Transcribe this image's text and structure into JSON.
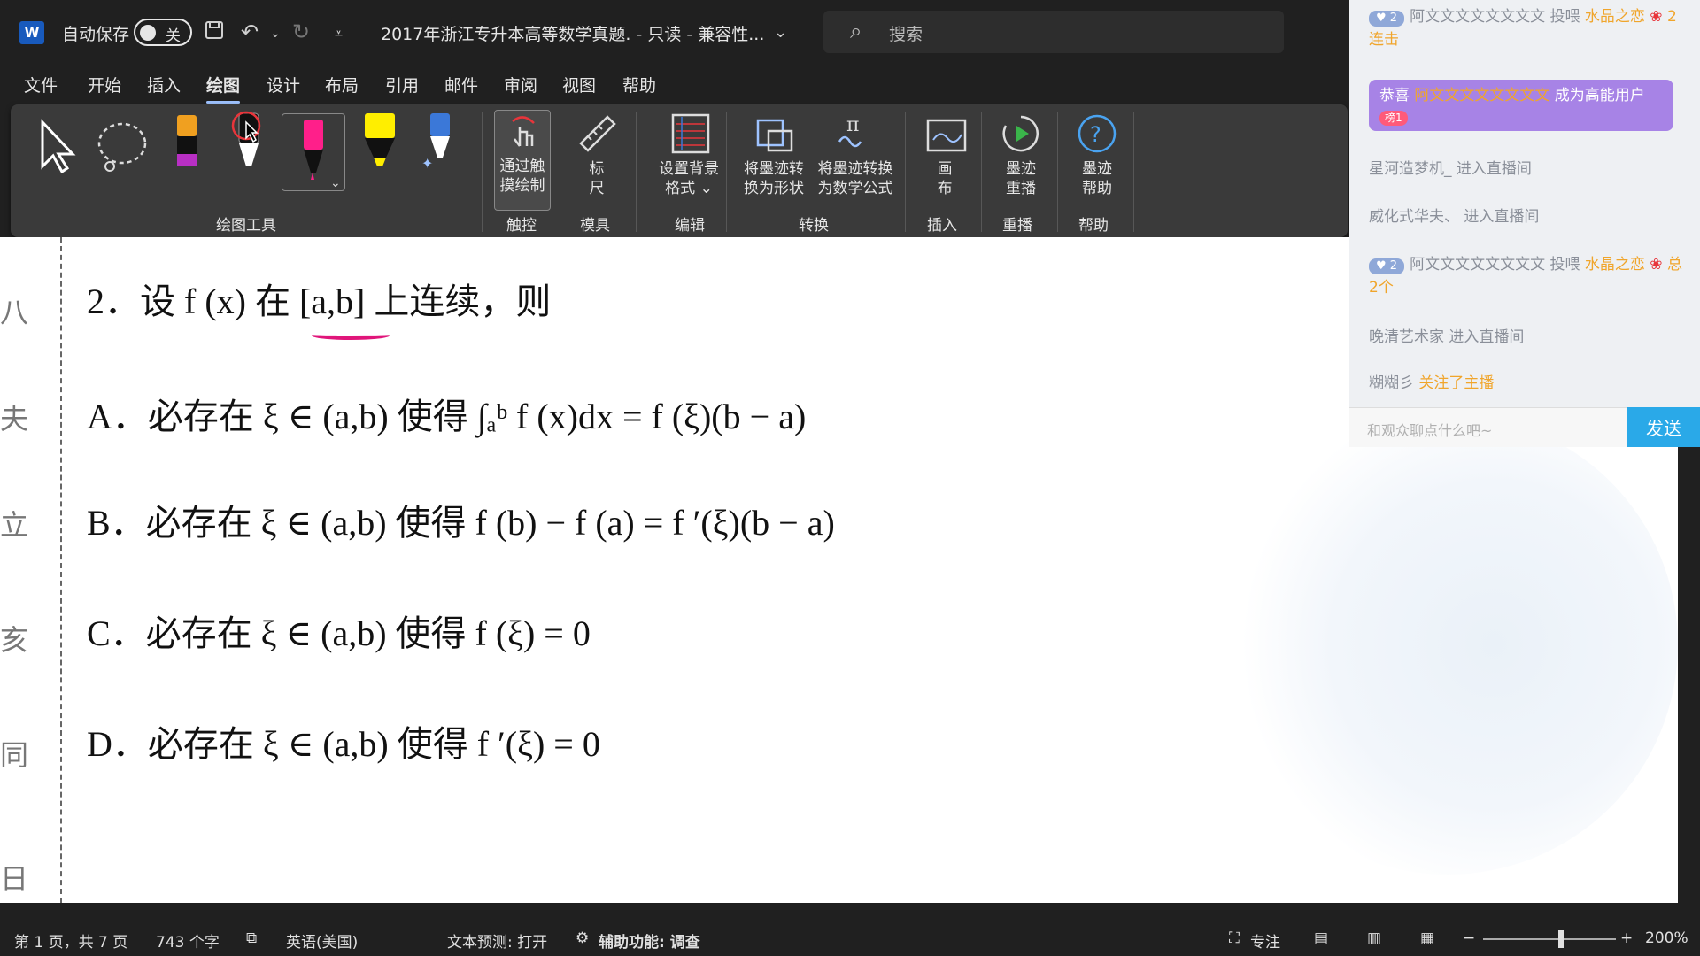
{
  "titlebar": {
    "autosave_label": "自动保存",
    "autosave_state": "关",
    "doc_title": "2017年浙江专升本高等数学真题.  -  只读  -  兼容性...",
    "search_placeholder": "搜索"
  },
  "menu": {
    "tabs": [
      "文件",
      "开始",
      "插入",
      "绘图",
      "设计",
      "布局",
      "引用",
      "邮件",
      "审阅",
      "视图",
      "帮助"
    ],
    "active": "绘图"
  },
  "ribbon": {
    "groups": {
      "drawing_tools": "绘图工具",
      "touch": "触控",
      "stencils": "模具",
      "edit": "编辑",
      "convert": "转换",
      "insert": "插入",
      "replay": "重播",
      "help": "帮助"
    },
    "buttons": {
      "touch_draw": [
        "通过触",
        "摸绘制"
      ],
      "ruler": [
        "标",
        "尺"
      ],
      "bg_format": [
        "设置背景",
        "格式 ⌄"
      ],
      "ink_to_shape": [
        "将墨迹转",
        "换为形状"
      ],
      "ink_to_math": [
        "将墨迹转换",
        "为数学公式"
      ],
      "canvas": [
        "画",
        "布"
      ],
      "ink_replay": [
        "墨迹",
        "重播"
      ],
      "ink_help": [
        "墨迹",
        "帮助"
      ]
    },
    "colors": {
      "pen_pink": "#ff1f8a",
      "highlighter_yellow": "#ffee00",
      "pen_blue": "#3b78d8",
      "pen_orange": "#f0a020",
      "pen_purple": "#b82fc4",
      "accent": "#9ec3ff"
    }
  },
  "document": {
    "question": "2．设 f (x) 在 [a,b] 上连续，则",
    "options": {
      "A": "A．必存在 ξ ∈ (a,b) 使得 ∫ₐᵇ f (x)dx = f (ξ)(b − a)",
      "B": "B．必存在 ξ ∈ (a,b) 使得 f (b) − f (a) = f ′(ξ)(b − a)",
      "C": "C．必存在 ξ ∈ (a,b) 使得 f (ξ) = 0",
      "D": "D．必存在 ξ ∈ (a,b) 使得 f ′(ξ) = 0"
    }
  },
  "statusbar": {
    "page": "第 1 页，共 7 页",
    "words": "743 个字",
    "language": "英语(美国)",
    "text_prediction": "文本预测: 打开",
    "accessibility": "辅助功能: 调查",
    "focus": "专注",
    "zoom": "200%"
  },
  "chat": {
    "items": [
      {
        "level": "2",
        "text": "阿文文文文文文文文 投喂 ",
        "gift": "水晶之恋",
        "extra": "2连击"
      },
      {
        "congrats_prefix": "恭喜 ",
        "user": "阿文文文文文文文文",
        "congrats_suffix": " 成为高能用户",
        "badge": "榜1"
      },
      {
        "text": "星河造梦机_ 进入直播间"
      },
      {
        "text": "威化式华夫、 进入直播间"
      },
      {
        "level": "2",
        "text": "阿文文文文文文文文 投喂 ",
        "gift": "水晶之恋",
        "extra": "总2个"
      },
      {
        "text": "晚清艺术家 进入直播间"
      },
      {
        "user": "糊糊彡 ",
        "action": "关注了主播"
      }
    ],
    "input_placeholder": "和观众聊点什么吧~",
    "send_label": "发送"
  }
}
